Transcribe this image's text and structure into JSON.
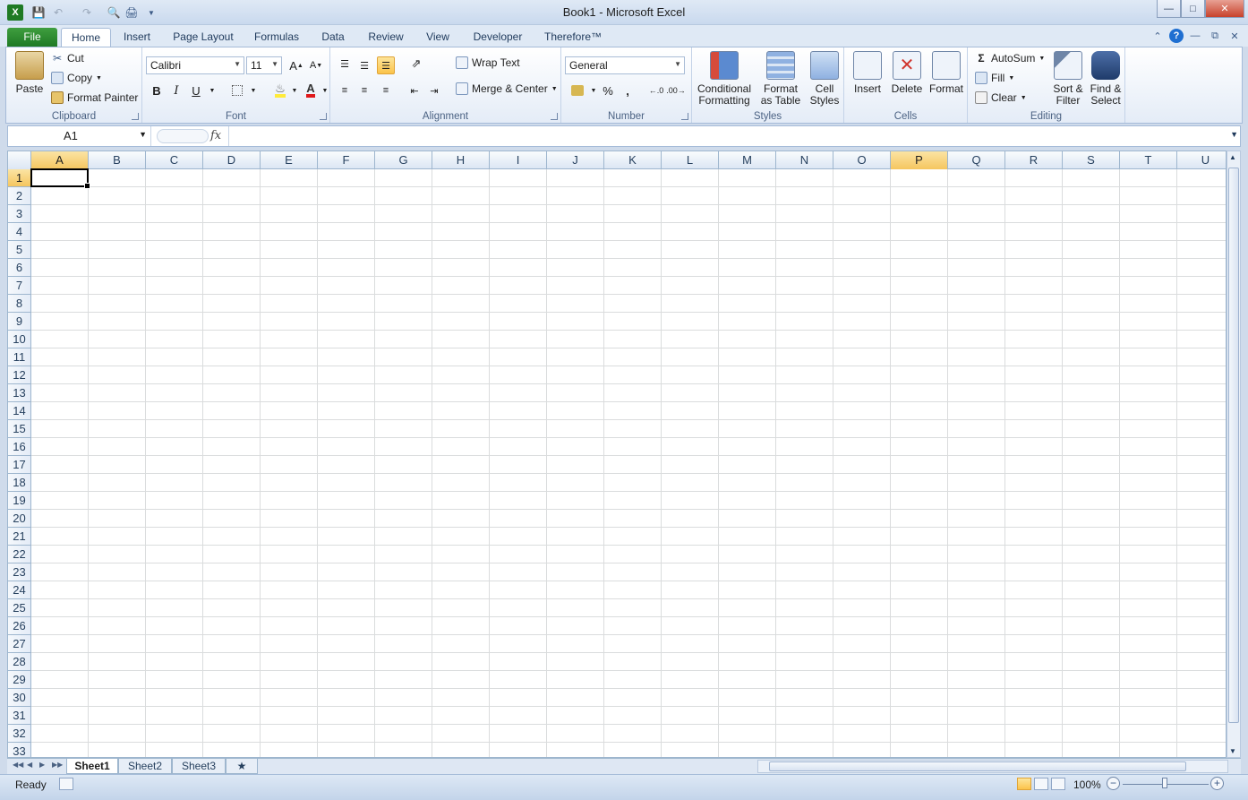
{
  "window": {
    "title": "Book1  -  Microsoft Excel"
  },
  "ribbon_tabs": [
    "File",
    "Home",
    "Insert",
    "Page Layout",
    "Formulas",
    "Data",
    "Review",
    "View",
    "Developer",
    "Therefore™"
  ],
  "active_tab": "Home",
  "clipboard": {
    "label": "Clipboard",
    "paste": "Paste",
    "cut": "Cut",
    "copy": "Copy",
    "format_painter": "Format Painter"
  },
  "font": {
    "label": "Font",
    "name": "Calibri",
    "size": "11",
    "bold": "B",
    "italic": "I",
    "underline": "U"
  },
  "alignment": {
    "label": "Alignment",
    "wrap_text": "Wrap Text",
    "merge_center": "Merge & Center"
  },
  "number": {
    "label": "Number",
    "format": "General",
    "percent": "%",
    "comma": ","
  },
  "styles": {
    "label": "Styles",
    "conditional_1": "Conditional",
    "conditional_2": "Formatting",
    "format_table_1": "Format",
    "format_table_2": "as Table",
    "cell_styles_1": "Cell",
    "cell_styles_2": "Styles"
  },
  "cells": {
    "label": "Cells",
    "insert": "Insert",
    "delete": "Delete",
    "format": "Format"
  },
  "editing": {
    "label": "Editing",
    "autosum": "AutoSum",
    "fill": "Fill",
    "clear": "Clear",
    "sort_1": "Sort &",
    "sort_2": "Filter",
    "find_1": "Find &",
    "find_2": "Select"
  },
  "formula_bar": {
    "name_box": "A1",
    "fx": "fx",
    "formula": ""
  },
  "columns": [
    "A",
    "B",
    "C",
    "D",
    "E",
    "F",
    "G",
    "H",
    "I",
    "J",
    "K",
    "L",
    "M",
    "N",
    "O",
    "P",
    "Q",
    "R",
    "S",
    "T",
    "U"
  ],
  "rows": [
    "1",
    "2",
    "3",
    "4",
    "5",
    "6",
    "7",
    "8",
    "9",
    "10",
    "11",
    "12",
    "13",
    "14",
    "15",
    "16",
    "17",
    "18",
    "19",
    "20",
    "21",
    "22",
    "23",
    "24",
    "25",
    "26",
    "27",
    "28",
    "29",
    "30",
    "31",
    "32",
    "33"
  ],
  "selected_column": "A",
  "highlighted_column": "P",
  "selected_row": "1",
  "sheets": [
    "Sheet1",
    "Sheet2",
    "Sheet3"
  ],
  "active_sheet": "Sheet1",
  "status": {
    "text": "Ready",
    "zoom": "100%"
  },
  "colors": {
    "file_tab": "#2a8a2e",
    "selection_highlight": "#f5c65f",
    "ribbon_bg": "#dfe9f5"
  }
}
